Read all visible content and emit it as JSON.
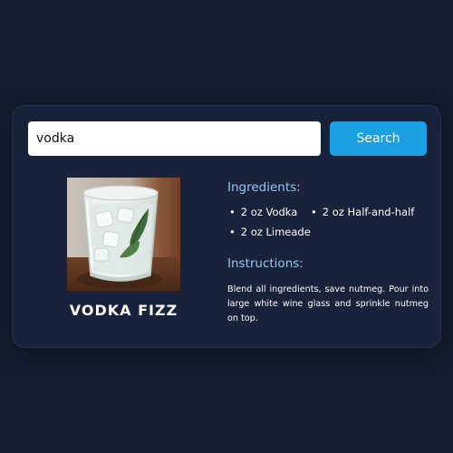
{
  "search": {
    "value": "vodka",
    "button_label": "Search"
  },
  "drink": {
    "name": "VODKA FIZZ",
    "image_icon": "cocktail-glass-photo",
    "ingredients_heading": "Ingredients:",
    "ingredients": [
      "2 oz Vodka",
      "2 oz Half-and-half",
      "2 oz Limeade"
    ],
    "instructions_heading": "Instructions:",
    "instructions": "Blend all ingredients, save nutmeg. Pour into large white wine glass and sprinkle nutmeg on top."
  },
  "colors": {
    "page_background": "#131c30",
    "card_background": "#18223a",
    "accent": "#1ba0e3",
    "heading": "#9cc7e8"
  }
}
